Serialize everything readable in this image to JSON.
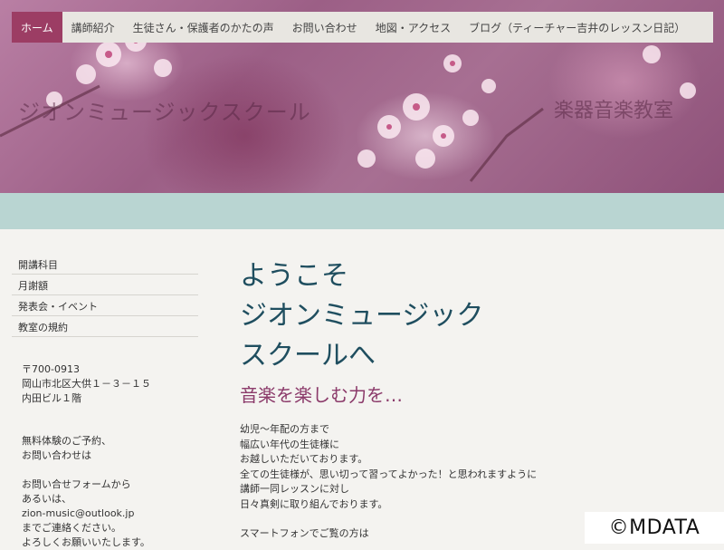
{
  "nav": {
    "items": [
      {
        "label": "ホーム",
        "active": true
      },
      {
        "label": "講師紹介"
      },
      {
        "label": "生徒さん・保護者のかたの声"
      },
      {
        "label": "お問い合わせ"
      },
      {
        "label": "地図・アクセス"
      },
      {
        "label": "ブログ（ティーチャー吉井のレッスン日記）"
      }
    ]
  },
  "header": {
    "site_title": "ジオンミュージックスクール",
    "site_subtitle": "楽器音楽教室"
  },
  "sidebar": {
    "menu": [
      "開講科目",
      "月謝額",
      "発表会・イベント",
      "教室の規約"
    ],
    "address": [
      "〒700-0913",
      "岡山市北区大供１－３－１５",
      "内田ビル１階"
    ],
    "contact": [
      "無料体験のご予約、",
      "お問い合わせは",
      "",
      "お問い合せフォームから",
      "あるいは、",
      "zion-music@outlook.jp",
      "までご連絡ください。",
      "よろしくお願いいたします。"
    ]
  },
  "main": {
    "welcome_lines": [
      "ようこそ",
      "ジオンミュージック",
      "スクールへ"
    ],
    "tagline": "音楽を楽しむ力を…",
    "intro_lines": [
      "幼児～年配の方まで",
      "幅広い年代の生徒様に",
      "お越しいただいております。",
      "全ての生徒様が、思い切って習ってよかった！と思われますように",
      "講師一同レッスンに対し",
      "日々真剣に取り組んでおります。",
      "",
      "スマートフォンでご覧の方は"
    ]
  },
  "watermark": "©MDATA",
  "colors": {
    "nav_active": "#9c3d64",
    "band": "#b9d5d2",
    "heading": "#1f4e5f",
    "tagline": "#8b3a6a"
  }
}
